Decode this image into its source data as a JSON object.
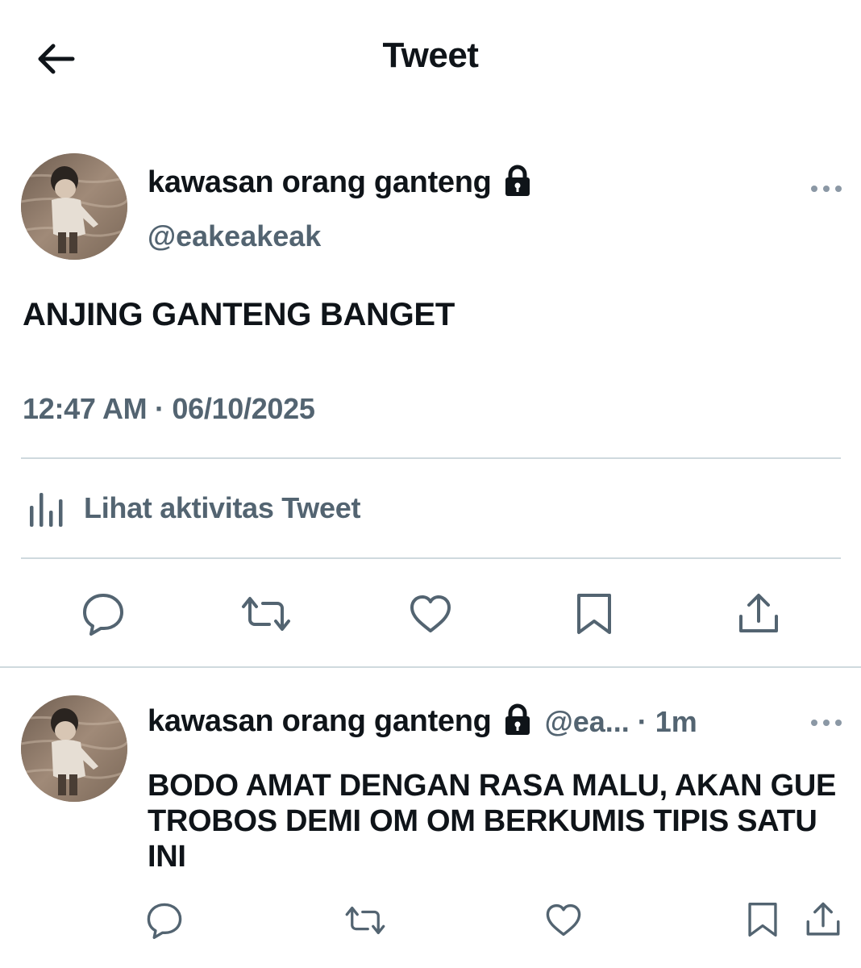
{
  "header": {
    "title": "Tweet"
  },
  "tweet": {
    "author_name": "kawasan orang ganteng",
    "handle": "@eakeakeak",
    "text": "ANJING GANTENG BANGET",
    "timestamp": "12:47 AM · 06/10/2025",
    "activity_label": "Lihat aktivitas Tweet"
  },
  "reply": {
    "author_name": "kawasan orang ganteng",
    "handle_time": "@ea... · 1m",
    "text": "BODO AMAT DENGAN RASA MALU, AKAN GUE TROBOS DEMI OM OM BERKUMIS TIPIS SATU INI"
  },
  "icons": {
    "back": "arrow-left-icon",
    "lock": "lock-icon",
    "more": "more-horizontal-icon",
    "activity": "bar-chart-icon",
    "reply": "reply-icon",
    "retweet": "retweet-icon",
    "like": "heart-icon",
    "bookmark": "bookmark-icon",
    "share": "share-icon"
  },
  "colors": {
    "text": "#0f1419",
    "secondary": "#536471",
    "divider": "#cfd9de"
  }
}
